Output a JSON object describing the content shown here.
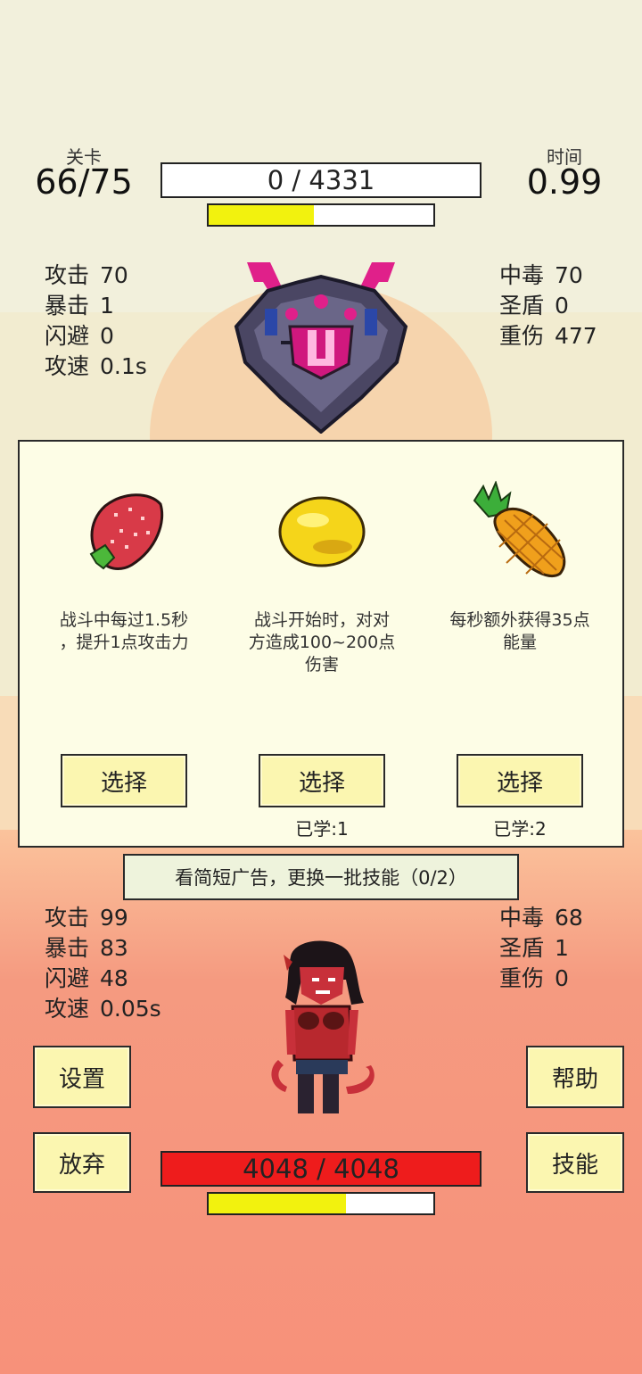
{
  "header": {
    "level_label": "关卡",
    "level_value": "66/75",
    "time_label": "时间",
    "time_value": "0.99",
    "enemy_hp_text": "0 / 4331",
    "enemy_hp_fraction": 0.0,
    "enemy_energy_fraction": 0.47
  },
  "enemy_stats_left": [
    {
      "label": "攻击",
      "value": "70"
    },
    {
      "label": "暴击",
      "value": "1"
    },
    {
      "label": "闪避",
      "value": "0"
    },
    {
      "label": "攻速",
      "value": "0.1s"
    }
  ],
  "enemy_stats_right": [
    {
      "label": "中毒",
      "value": "70"
    },
    {
      "label": "圣盾",
      "value": "0"
    },
    {
      "label": "重伤",
      "value": "477"
    }
  ],
  "skills": [
    {
      "icon": "strawberry-icon",
      "desc_lines": [
        "战斗中每过1.5秒",
        "，提升1点攻击力"
      ],
      "button": "选择",
      "learned": ""
    },
    {
      "icon": "lemon-icon",
      "desc_lines": [
        "战斗开始时，对对",
        "方造成100~200点",
        "伤害"
      ],
      "button": "选择",
      "learned": "已学:1"
    },
    {
      "icon": "pineapple-icon",
      "desc_lines": [
        "每秒额外获得35点",
        "能量"
      ],
      "button": "选择",
      "learned": "已学:2"
    }
  ],
  "ad_refresh_label": "看简短广告，更换一批技能（0/2）",
  "player_stats_left": [
    {
      "label": "攻击",
      "value": "99"
    },
    {
      "label": "暴击",
      "value": "83"
    },
    {
      "label": "闪避",
      "value": "48"
    },
    {
      "label": "攻速",
      "value": "0.05s"
    }
  ],
  "player_stats_right": [
    {
      "label": "中毒",
      "value": "68"
    },
    {
      "label": "圣盾",
      "value": "1"
    },
    {
      "label": "重伤",
      "value": "0"
    }
  ],
  "buttons": {
    "settings": "设置",
    "help": "帮助",
    "give_up": "放弃",
    "skills": "技能"
  },
  "player": {
    "hp_text": "4048 / 4048",
    "hp_fraction": 1.0,
    "energy_fraction": 0.61
  },
  "colors": {
    "hp_red": "#ee1c1c",
    "energy_yellow": "#f2f20e",
    "button_bg": "#fbf6b0"
  }
}
